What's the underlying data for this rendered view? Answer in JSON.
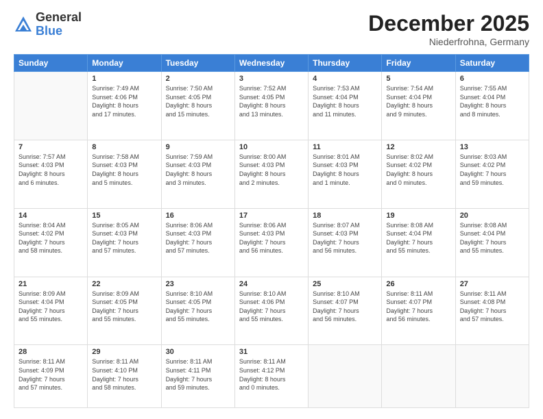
{
  "header": {
    "logo": {
      "general": "General",
      "blue": "Blue"
    },
    "title": "December 2025",
    "location": "Niederfrohna, Germany"
  },
  "calendar": {
    "weekdays": [
      "Sunday",
      "Monday",
      "Tuesday",
      "Wednesday",
      "Thursday",
      "Friday",
      "Saturday"
    ],
    "weeks": [
      [
        {
          "day": "",
          "info": ""
        },
        {
          "day": "1",
          "info": "Sunrise: 7:49 AM\nSunset: 4:06 PM\nDaylight: 8 hours\nand 17 minutes."
        },
        {
          "day": "2",
          "info": "Sunrise: 7:50 AM\nSunset: 4:05 PM\nDaylight: 8 hours\nand 15 minutes."
        },
        {
          "day": "3",
          "info": "Sunrise: 7:52 AM\nSunset: 4:05 PM\nDaylight: 8 hours\nand 13 minutes."
        },
        {
          "day": "4",
          "info": "Sunrise: 7:53 AM\nSunset: 4:04 PM\nDaylight: 8 hours\nand 11 minutes."
        },
        {
          "day": "5",
          "info": "Sunrise: 7:54 AM\nSunset: 4:04 PM\nDaylight: 8 hours\nand 9 minutes."
        },
        {
          "day": "6",
          "info": "Sunrise: 7:55 AM\nSunset: 4:04 PM\nDaylight: 8 hours\nand 8 minutes."
        }
      ],
      [
        {
          "day": "7",
          "info": "Sunrise: 7:57 AM\nSunset: 4:03 PM\nDaylight: 8 hours\nand 6 minutes."
        },
        {
          "day": "8",
          "info": "Sunrise: 7:58 AM\nSunset: 4:03 PM\nDaylight: 8 hours\nand 5 minutes."
        },
        {
          "day": "9",
          "info": "Sunrise: 7:59 AM\nSunset: 4:03 PM\nDaylight: 8 hours\nand 3 minutes."
        },
        {
          "day": "10",
          "info": "Sunrise: 8:00 AM\nSunset: 4:03 PM\nDaylight: 8 hours\nand 2 minutes."
        },
        {
          "day": "11",
          "info": "Sunrise: 8:01 AM\nSunset: 4:03 PM\nDaylight: 8 hours\nand 1 minute."
        },
        {
          "day": "12",
          "info": "Sunrise: 8:02 AM\nSunset: 4:02 PM\nDaylight: 8 hours\nand 0 minutes."
        },
        {
          "day": "13",
          "info": "Sunrise: 8:03 AM\nSunset: 4:02 PM\nDaylight: 7 hours\nand 59 minutes."
        }
      ],
      [
        {
          "day": "14",
          "info": "Sunrise: 8:04 AM\nSunset: 4:02 PM\nDaylight: 7 hours\nand 58 minutes."
        },
        {
          "day": "15",
          "info": "Sunrise: 8:05 AM\nSunset: 4:03 PM\nDaylight: 7 hours\nand 57 minutes."
        },
        {
          "day": "16",
          "info": "Sunrise: 8:06 AM\nSunset: 4:03 PM\nDaylight: 7 hours\nand 57 minutes."
        },
        {
          "day": "17",
          "info": "Sunrise: 8:06 AM\nSunset: 4:03 PM\nDaylight: 7 hours\nand 56 minutes."
        },
        {
          "day": "18",
          "info": "Sunrise: 8:07 AM\nSunset: 4:03 PM\nDaylight: 7 hours\nand 56 minutes."
        },
        {
          "day": "19",
          "info": "Sunrise: 8:08 AM\nSunset: 4:04 PM\nDaylight: 7 hours\nand 55 minutes."
        },
        {
          "day": "20",
          "info": "Sunrise: 8:08 AM\nSunset: 4:04 PM\nDaylight: 7 hours\nand 55 minutes."
        }
      ],
      [
        {
          "day": "21",
          "info": "Sunrise: 8:09 AM\nSunset: 4:04 PM\nDaylight: 7 hours\nand 55 minutes."
        },
        {
          "day": "22",
          "info": "Sunrise: 8:09 AM\nSunset: 4:05 PM\nDaylight: 7 hours\nand 55 minutes."
        },
        {
          "day": "23",
          "info": "Sunrise: 8:10 AM\nSunset: 4:05 PM\nDaylight: 7 hours\nand 55 minutes."
        },
        {
          "day": "24",
          "info": "Sunrise: 8:10 AM\nSunset: 4:06 PM\nDaylight: 7 hours\nand 55 minutes."
        },
        {
          "day": "25",
          "info": "Sunrise: 8:10 AM\nSunset: 4:07 PM\nDaylight: 7 hours\nand 56 minutes."
        },
        {
          "day": "26",
          "info": "Sunrise: 8:11 AM\nSunset: 4:07 PM\nDaylight: 7 hours\nand 56 minutes."
        },
        {
          "day": "27",
          "info": "Sunrise: 8:11 AM\nSunset: 4:08 PM\nDaylight: 7 hours\nand 57 minutes."
        }
      ],
      [
        {
          "day": "28",
          "info": "Sunrise: 8:11 AM\nSunset: 4:09 PM\nDaylight: 7 hours\nand 57 minutes."
        },
        {
          "day": "29",
          "info": "Sunrise: 8:11 AM\nSunset: 4:10 PM\nDaylight: 7 hours\nand 58 minutes."
        },
        {
          "day": "30",
          "info": "Sunrise: 8:11 AM\nSunset: 4:11 PM\nDaylight: 7 hours\nand 59 minutes."
        },
        {
          "day": "31",
          "info": "Sunrise: 8:11 AM\nSunset: 4:12 PM\nDaylight: 8 hours\nand 0 minutes."
        },
        {
          "day": "",
          "info": ""
        },
        {
          "day": "",
          "info": ""
        },
        {
          "day": "",
          "info": ""
        }
      ]
    ]
  }
}
